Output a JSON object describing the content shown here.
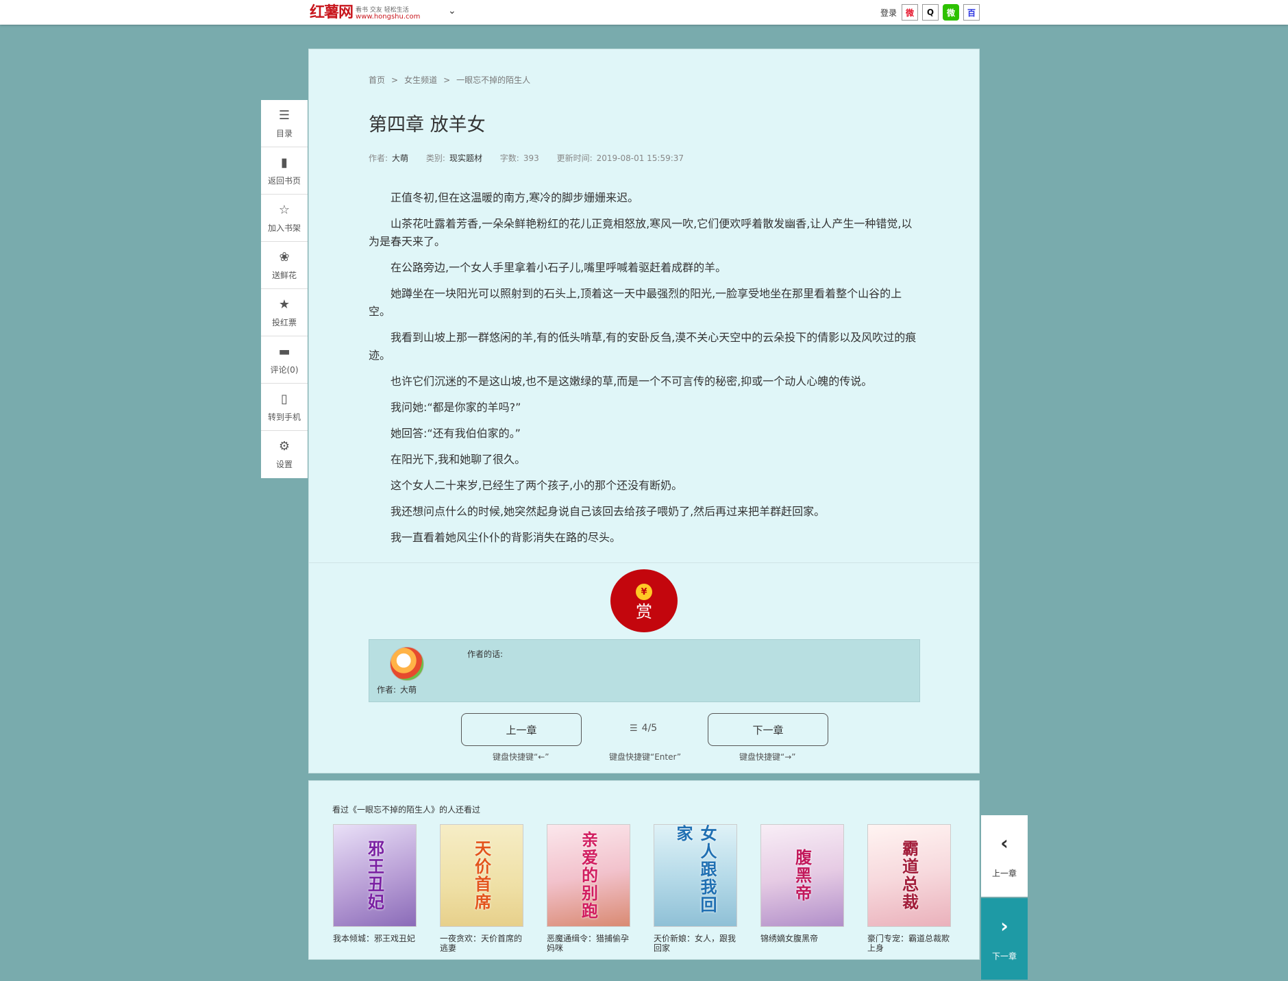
{
  "topbar": {
    "logo_text": "红薯网",
    "logo_slogan": "看书 交友 轻松生活",
    "logo_url": "www.hongshu.com",
    "login_label": "登录",
    "social": [
      {
        "name": "weibo",
        "glyph": "微"
      },
      {
        "name": "qq",
        "glyph": "Q"
      },
      {
        "name": "wechat",
        "glyph": "微"
      },
      {
        "name": "baidu",
        "glyph": "百"
      }
    ]
  },
  "sidebar": {
    "items": [
      {
        "label": "目录",
        "icon": "list-icon",
        "glyph": "☰"
      },
      {
        "label": "返回书页",
        "icon": "book-icon",
        "glyph": "▮"
      },
      {
        "label": "加入书架",
        "icon": "star-icon",
        "glyph": "☆"
      },
      {
        "label": "送鲜花",
        "icon": "flower-icon",
        "glyph": "❀"
      },
      {
        "label": "投红票",
        "icon": "ticket-icon",
        "glyph": "★"
      },
      {
        "label": "评论(0)",
        "icon": "comment-icon",
        "glyph": "▬"
      },
      {
        "label": "转到手机",
        "icon": "phone-icon",
        "glyph": "▯"
      },
      {
        "label": "设置",
        "icon": "gear-icon",
        "glyph": "⚙"
      }
    ]
  },
  "breadcrumb": {
    "home": "首页",
    "channel": "女生频道",
    "book": "一眼忘不掉的陌生人",
    "sep": ">"
  },
  "chapter": {
    "title": "第四章 放羊女",
    "author_label": "作者:",
    "author": "大萌",
    "category_label": "类别:",
    "category": "现实题材",
    "wordcount_label": "字数:",
    "wordcount": "393",
    "updated_label": "更新时间:",
    "updated": "2019-08-01 15:59:37",
    "paragraphs": [
      "正值冬初,但在这温暖的南方,寒冷的脚步姗姗来迟。",
      "山茶花吐露着芳香,一朵朵鲜艳粉红的花儿正竟相怒放,寒风一吹,它们便欢呼着散发幽香,让人产生一种错觉,以为是春天来了。",
      "在公路旁边,一个女人手里拿着小石子儿,嘴里呼喊着驱赶着成群的羊。",
      "她蹲坐在一块阳光可以照射到的石头上,顶着这一天中最强烈的阳光,一脸享受地坐在那里看着整个山谷的上空。",
      "我看到山坡上那一群悠闲的羊,有的低头啃草,有的安卧反刍,漠不关心天空中的云朵投下的倩影以及风吹过的痕迹。",
      "也许它们沉迷的不是这山坡,也不是这嫩绿的草,而是一个不可言传的秘密,抑或一个动人心魄的传说。",
      "我问她:“都是你家的羊吗?”",
      "她回答:“还有我伯伯家的。”",
      "在阳光下,我和她聊了很久。",
      "这个女人二十来岁,已经生了两个孩子,小的那个还没有断奶。",
      "我还想问点什么的时候,她突然起身说自己该回去给孩子喂奶了,然后再过来把羊群赶回家。",
      "我一直看着她风尘仆仆的背影消失在路的尽头。"
    ]
  },
  "reward": {
    "label": "赏",
    "coin": "¥"
  },
  "author_box": {
    "name_label": "作者:",
    "name": "大萌",
    "words_label": "作者的话:"
  },
  "nav": {
    "prev_label": "上一章",
    "next_label": "下一章",
    "progress": "4/5",
    "prev_shortcut": "键盘快捷键“←”",
    "enter_shortcut": "键盘快捷键“Enter”",
    "next_shortcut": "键盘快捷键“→”"
  },
  "recommend": {
    "title": "看过《一眼忘不掉的陌生人》的人还看过",
    "books": [
      {
        "title": "我本倾城：邪王戏丑妃",
        "cover_text": "邪王丑妃"
      },
      {
        "title": "一夜贪欢：天价首席的逃妻",
        "cover_text": "天价首席"
      },
      {
        "title": "恶魔通缉令：猎捕偷孕妈咪",
        "cover_text": "亲爱的别跑"
      },
      {
        "title": "天价新娘：女人，跟我回家",
        "cover_text": "女人跟我回家"
      },
      {
        "title": "锦绣嫡女腹黑帝",
        "cover_text": "腹黑帝"
      },
      {
        "title": "豪门专宠：霸道总裁欺上身",
        "cover_text": "霸道总裁"
      }
    ]
  },
  "float_nav": {
    "prev_label": "上一章",
    "next_label": "下一章",
    "prev_glyph": "‹",
    "next_glyph": "›"
  }
}
